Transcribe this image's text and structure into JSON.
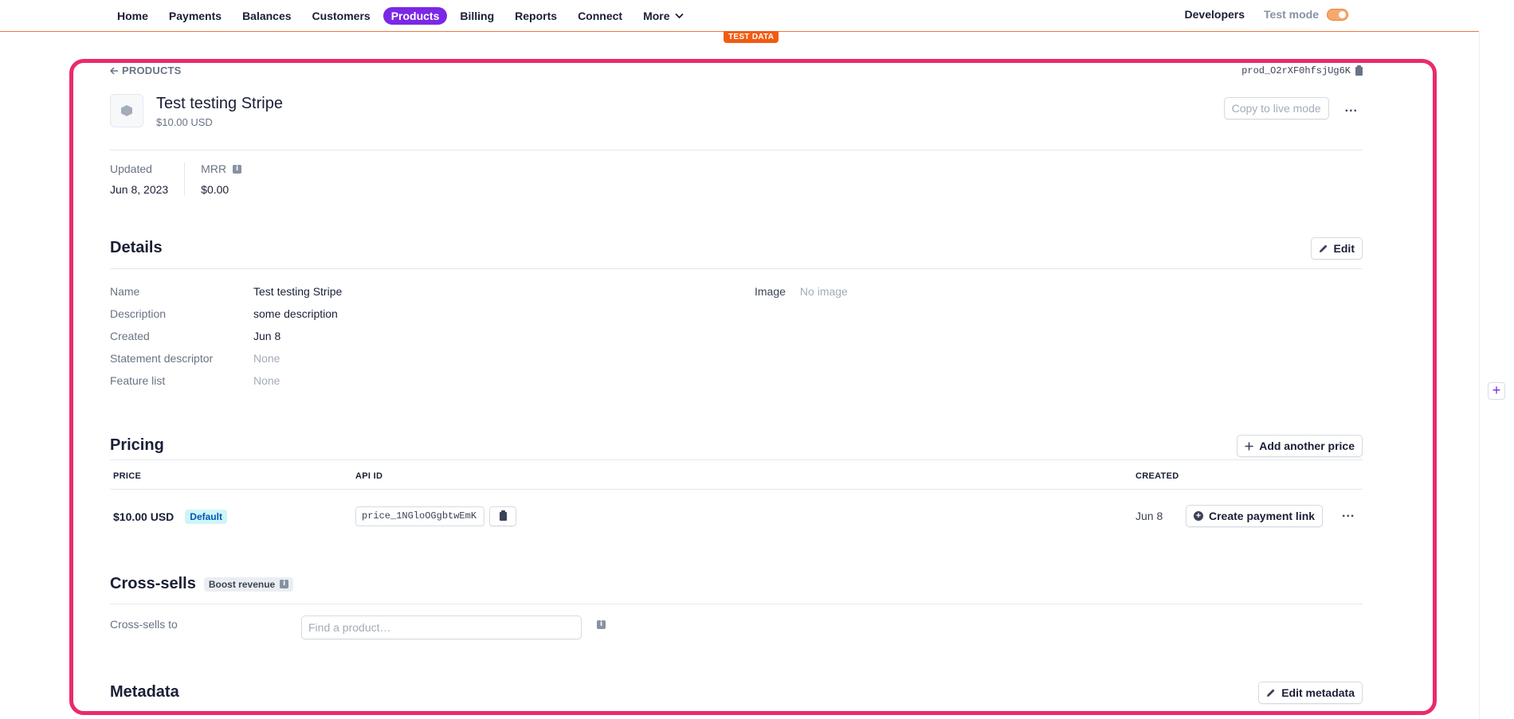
{
  "nav": {
    "items": [
      {
        "label": "Home",
        "active": false
      },
      {
        "label": "Payments",
        "active": false
      },
      {
        "label": "Balances",
        "active": false
      },
      {
        "label": "Customers",
        "active": false
      },
      {
        "label": "Products",
        "active": true
      },
      {
        "label": "Billing",
        "active": false
      },
      {
        "label": "Reports",
        "active": false
      },
      {
        "label": "Connect",
        "active": false
      },
      {
        "label": "More",
        "active": false
      }
    ],
    "developers": "Developers",
    "test_mode": "Test mode",
    "test_data_badge": "TEST DATA"
  },
  "product": {
    "back_label": "PRODUCTS",
    "id": "prod_O2rXF0hfsjUg6K",
    "title": "Test testing Stripe",
    "price": "$10.00 USD",
    "copy_live": "Copy to live mode",
    "more": "..."
  },
  "stats": {
    "updated_label": "Updated",
    "updated_value": "Jun 8, 2023",
    "mrr_label": "MRR",
    "mrr_value": "$0.00"
  },
  "details": {
    "title": "Details",
    "edit": "Edit",
    "rows": [
      {
        "key": "Name",
        "value": "Test testing Stripe",
        "muted": false
      },
      {
        "key": "Description",
        "value": "some description",
        "muted": false
      },
      {
        "key": "Created",
        "value": "Jun 8",
        "muted": false
      },
      {
        "key": "Statement descriptor",
        "value": "None",
        "muted": true
      },
      {
        "key": "Feature list",
        "value": "None",
        "muted": true
      }
    ],
    "image_label": "Image",
    "image_value": "No image"
  },
  "pricing": {
    "title": "Pricing",
    "add_price": "Add another price",
    "col_price": "PRICE",
    "col_api": "API ID",
    "col_created": "CREATED",
    "row": {
      "price": "$10.00 USD",
      "badge": "Default",
      "api_id": "price_1NGloOGgbtwEmK",
      "created": "Jun 8",
      "payment_link": "Create payment link",
      "more": "..."
    }
  },
  "crosssells": {
    "title": "Cross-sells",
    "boost": "Boost revenue",
    "label": "Cross-sells to",
    "placeholder": "Find a product…"
  },
  "metadata": {
    "title": "Metadata",
    "edit": "Edit metadata"
  },
  "colors": {
    "accent": "#7a28e6",
    "frame": "#ea2a6c",
    "test_badge": "#f25c12"
  }
}
